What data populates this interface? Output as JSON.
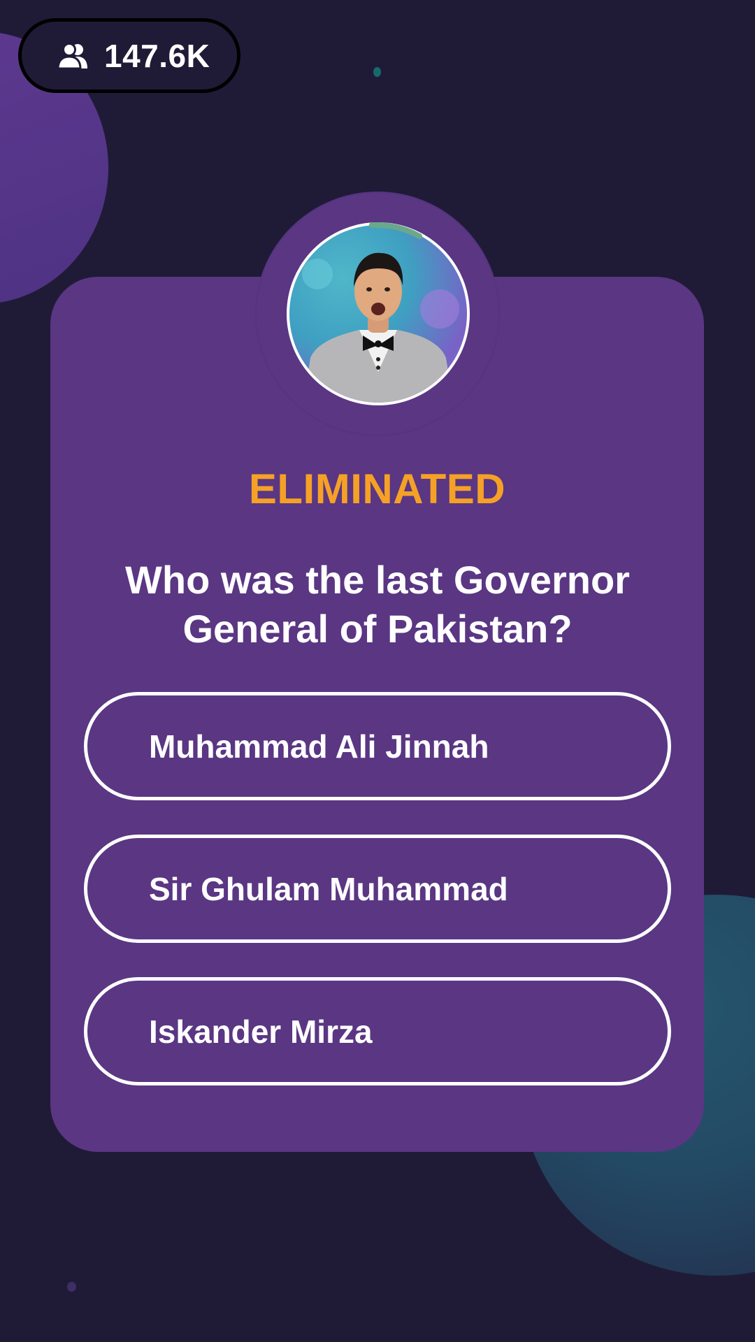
{
  "viewers": {
    "icon": "users-icon",
    "count": "147.6K"
  },
  "host": {
    "avatar_icon": "host-video-avatar",
    "timer_color": "#6aa88c"
  },
  "status": {
    "label": "ELIMINATED",
    "color": "#f5a126"
  },
  "question": {
    "line1": "Who was the last Governor",
    "line2": "General of Pakistan?"
  },
  "answers": [
    {
      "label": "Muhammad Ali Jinnah"
    },
    {
      "label": "Sir Ghulam Muhammad"
    },
    {
      "label": "Iskander Mirza"
    }
  ],
  "colors": {
    "background": "#1f1b36",
    "card": "#5a3683",
    "accent": "#f5a126"
  }
}
